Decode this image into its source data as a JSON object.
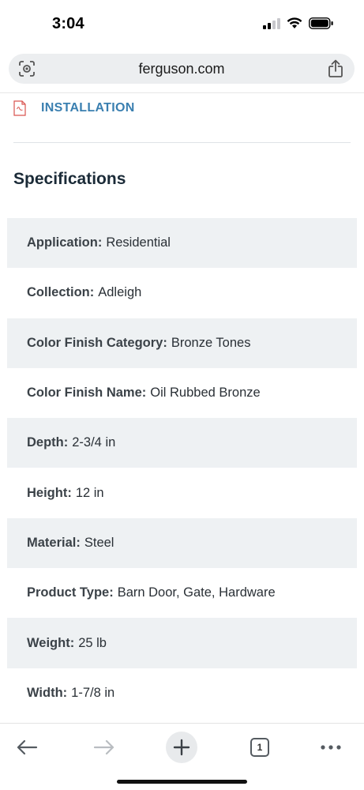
{
  "status_bar": {
    "time": "3:04",
    "icons": [
      "signal-icon",
      "wifi-icon",
      "battery-icon"
    ]
  },
  "browser": {
    "url": "ferguson.com",
    "lens_icon": "lens-icon",
    "share_icon": "share-icon"
  },
  "documents": {
    "installation_label": "INSTALLATION",
    "icon": "pdf-icon"
  },
  "specifications": {
    "heading": "Specifications",
    "rows": [
      {
        "key": "Application:",
        "value": "Residential"
      },
      {
        "key": "Collection:",
        "value": "Adleigh"
      },
      {
        "key": "Color Finish Category:",
        "value": "Bronze Tones"
      },
      {
        "key": "Color Finish Name:",
        "value": "Oil Rubbed Bronze"
      },
      {
        "key": "Depth:",
        "value": "2-3/4 in"
      },
      {
        "key": "Height:",
        "value": "12 in"
      },
      {
        "key": "Material:",
        "value": "Steel"
      },
      {
        "key": "Product Type:",
        "value": "Barn Door, Gate, Hardware"
      },
      {
        "key": "Weight:",
        "value": "25 lb"
      },
      {
        "key": "Width:",
        "value": "1-7/8 in"
      }
    ]
  },
  "toolbar": {
    "tab_count": "1",
    "icons": [
      "back-arrow-icon",
      "forward-arrow-icon",
      "plus-icon",
      "tabs-icon",
      "more-icon"
    ]
  },
  "colors": {
    "link": "#3a7fb0",
    "shaded_row": "#eef1f3",
    "heading": "#1b2b38"
  }
}
